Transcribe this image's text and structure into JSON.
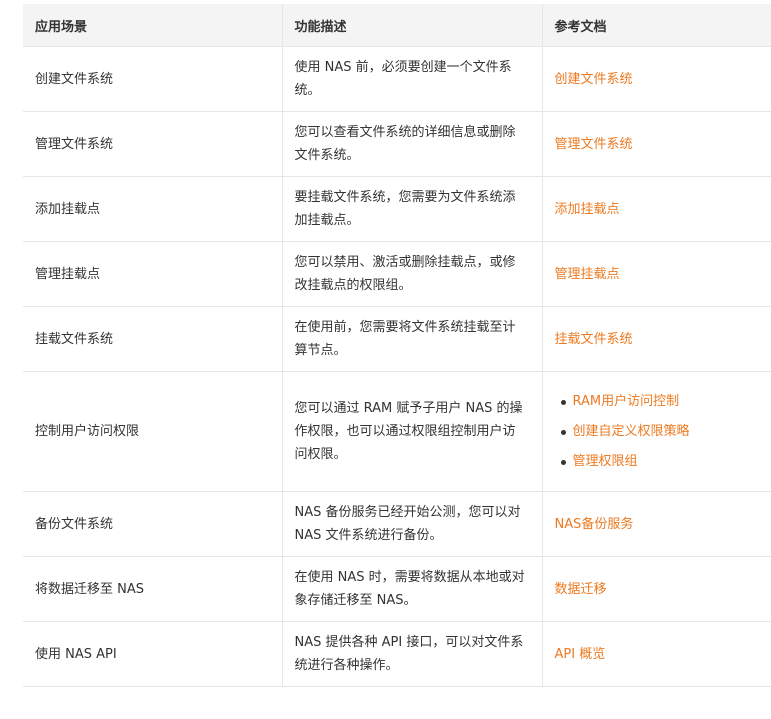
{
  "table": {
    "headers": [
      "应用场景",
      "功能描述",
      "参考文档"
    ],
    "rows": [
      {
        "scenario": "创建文件系统",
        "desc": "使用 NAS 前，必须要创建一个文件系统。",
        "links": [
          "创建文件系统"
        ]
      },
      {
        "scenario": "管理文件系统",
        "desc": "您可以查看文件系统的详细信息或删除文件系统。",
        "links": [
          "管理文件系统"
        ]
      },
      {
        "scenario": "添加挂载点",
        "desc": "要挂载文件系统，您需要为文件系统添加挂载点。",
        "links": [
          "添加挂载点"
        ]
      },
      {
        "scenario": "管理挂载点",
        "desc": "您可以禁用、激活或删除挂载点，或修改挂载点的权限组。",
        "links": [
          "管理挂载点"
        ]
      },
      {
        "scenario": "挂载文件系统",
        "desc": "在使用前，您需要将文件系统挂载至计算节点。",
        "links": [
          "挂载文件系统"
        ]
      },
      {
        "scenario": "控制用户访问权限",
        "desc": "您可以通过 RAM 赋予子用户 NAS 的操作权限，也可以通过权限组控制用户访问权限。",
        "links": [
          "RAM用户访问控制",
          "创建自定义权限策略",
          "管理权限组"
        ]
      },
      {
        "scenario": "备份文件系统",
        "desc": "NAS 备份服务已经开始公测，您可以对 NAS 文件系统进行备份。",
        "links": [
          "NAS备份服务"
        ]
      },
      {
        "scenario": "将数据迁移至 NAS",
        "desc": "在使用 NAS 时，需要将数据从本地或对象存储迁移至 NAS。",
        "links": [
          "数据迁移"
        ]
      },
      {
        "scenario": "使用 NAS API",
        "desc": "NAS 提供各种 API 接口，可以对文件系统进行各种操作。",
        "links": [
          "API 概览"
        ]
      }
    ]
  },
  "colors": {
    "link": "#ee7a21",
    "header_bg": "#f4f4f4",
    "border": "#e6e6e6",
    "text": "#333333"
  }
}
